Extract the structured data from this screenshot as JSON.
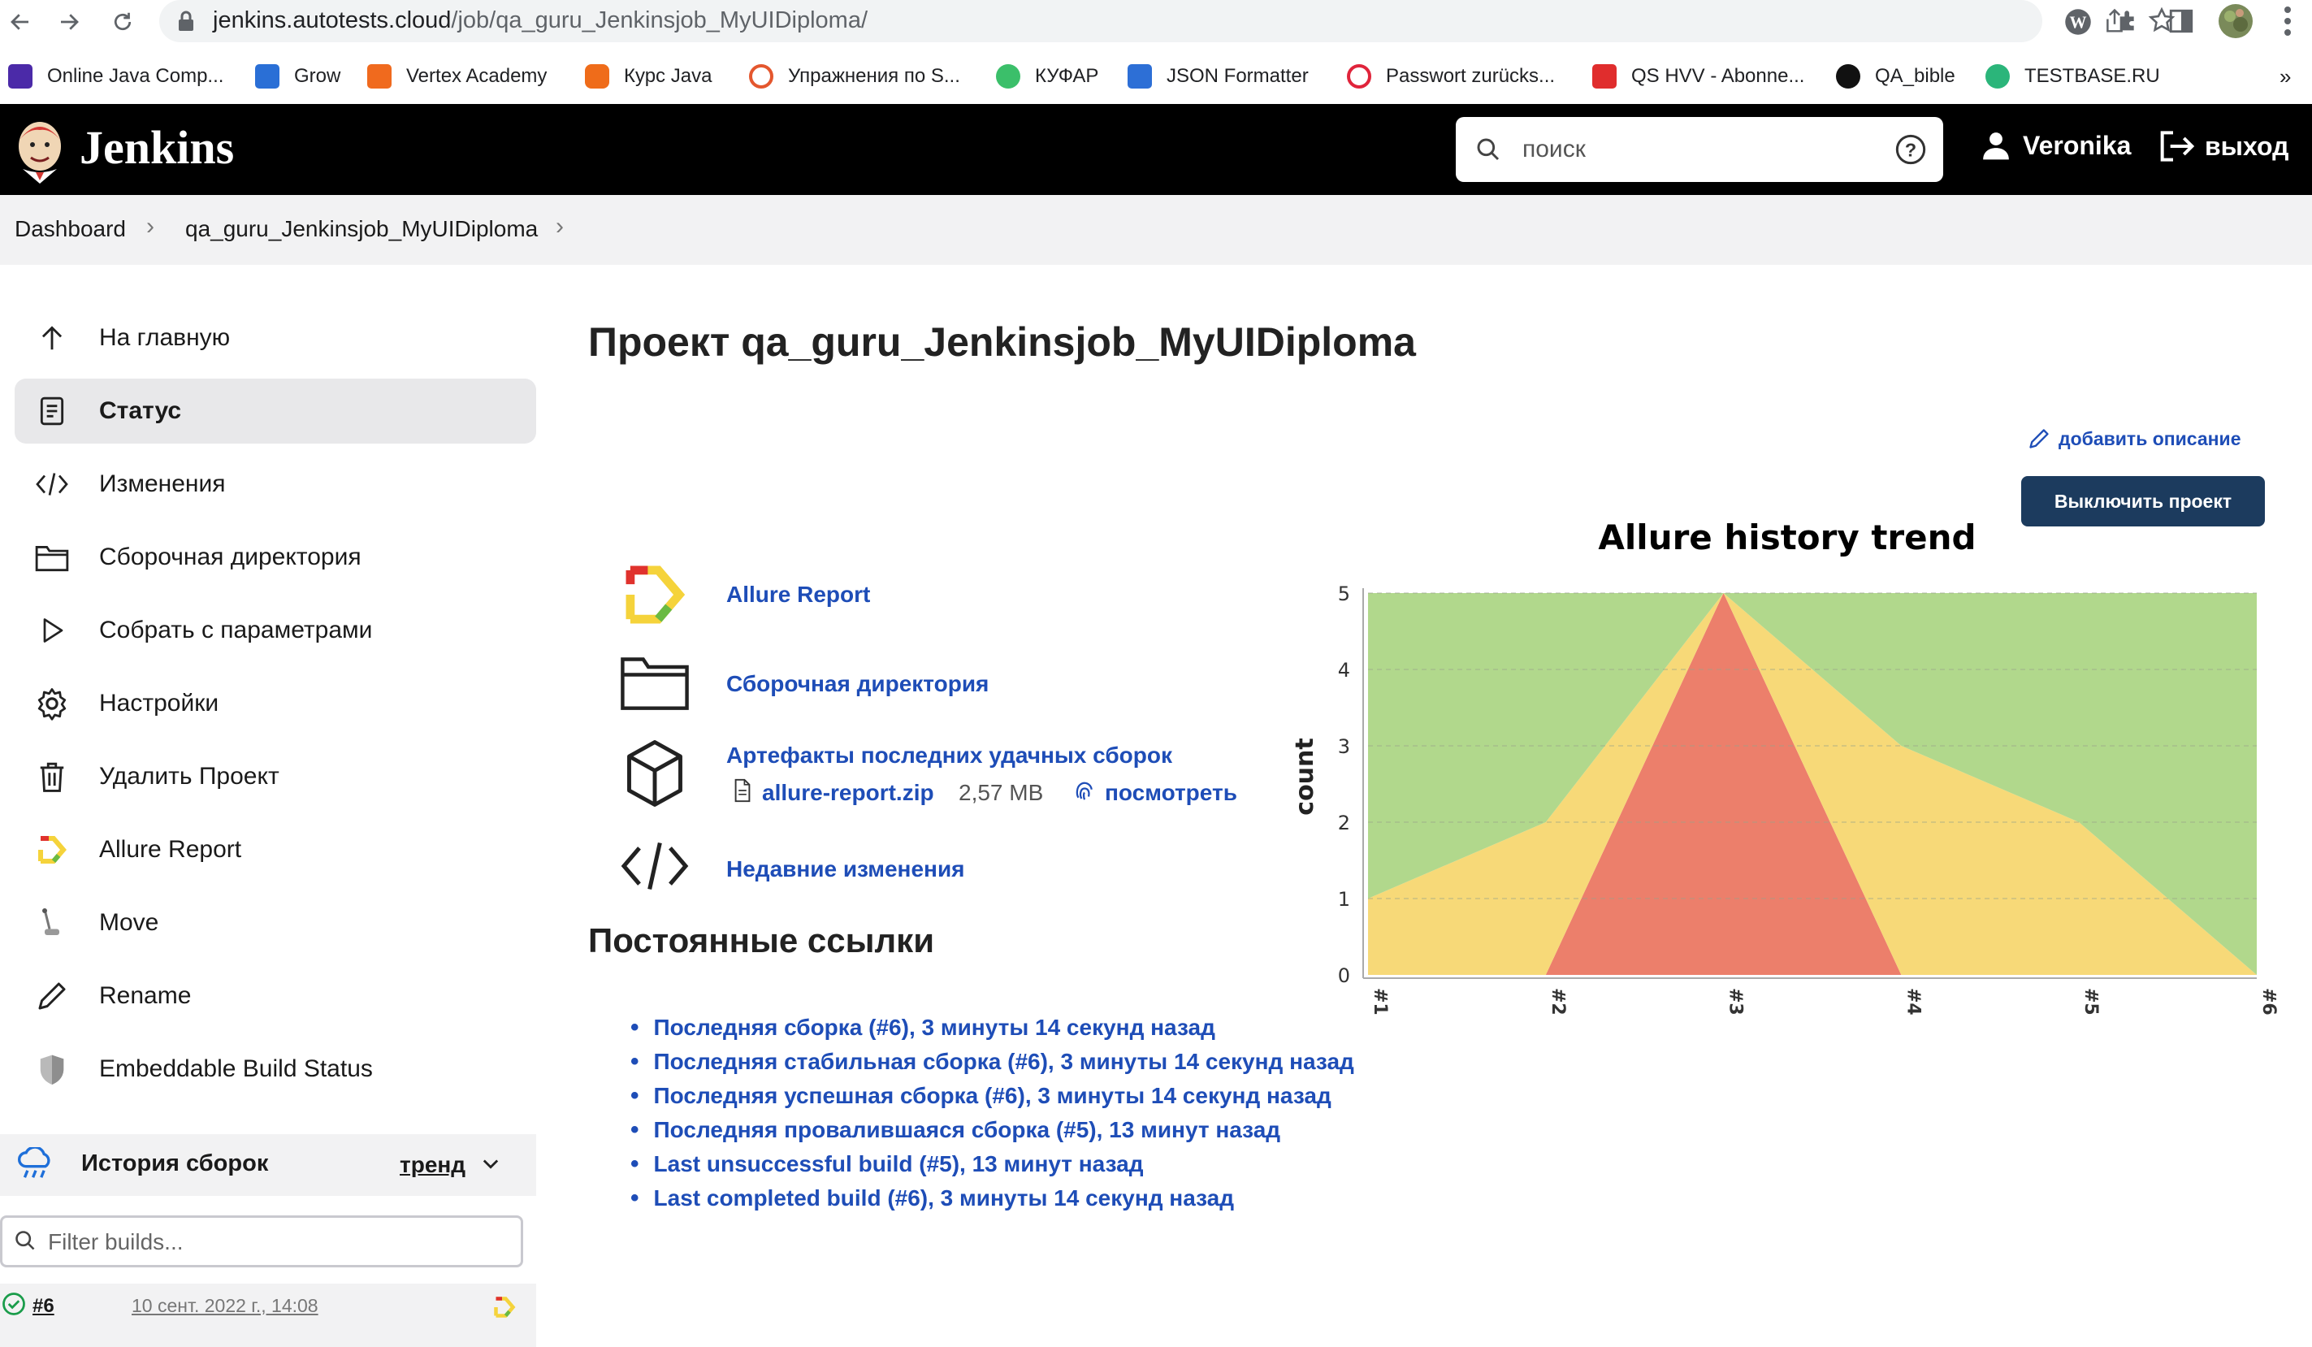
{
  "browser": {
    "url_host": "jenkins.autotests.cloud",
    "url_path": "/job/qa_guru_Jenkinsjob_MyUIDiploma/",
    "bookmarks": [
      {
        "label": "Online Java Comp...",
        "icon": "bolt-icon",
        "color": "#4b2aa8"
      },
      {
        "label": "Grow",
        "icon": "key-icon",
        "color": "#2a6fd6"
      },
      {
        "label": "Vertex Academy",
        "icon": "vertex-icon",
        "color": "#f06a1e"
      },
      {
        "label": "Курс Java",
        "icon": "hexagon-icon",
        "color": "#ef6c1a"
      },
      {
        "label": "Упражнения по S...",
        "icon": "target-icon",
        "color": "#e4572e"
      },
      {
        "label": "КУФАР",
        "icon": "kufar-icon",
        "color": "#3bbf6a"
      },
      {
        "label": "JSON Formatter",
        "icon": "check-icon",
        "color": "#2d6fd6"
      },
      {
        "label": "Passwort zurücks...",
        "icon": "swirl-icon",
        "color": "#e0243b"
      },
      {
        "label": "QS HVV - Abonne...",
        "icon": "play-icon",
        "color": "#e02d2d"
      },
      {
        "label": "QA_bible",
        "icon": "github-icon",
        "color": "#111111"
      },
      {
        "label": "TESTBASE.RU",
        "icon": "gear-icon",
        "color": "#2bb57a"
      }
    ]
  },
  "header": {
    "logo": "Jenkins",
    "search_placeholder": "поиск",
    "user": "Veronika",
    "logout": "выход"
  },
  "breadcrumb": {
    "items": [
      "Dashboard",
      "qa_guru_Jenkinsjob_MyUIDiploma"
    ]
  },
  "sidebar": {
    "items": [
      {
        "label": "На главную",
        "icon": "arrow-up-icon"
      },
      {
        "label": "Статус",
        "icon": "document-icon"
      },
      {
        "label": "Изменения",
        "icon": "code-icon"
      },
      {
        "label": "Сборочная директория",
        "icon": "folder-icon"
      },
      {
        "label": "Собрать с параметрами",
        "icon": "play-icon"
      },
      {
        "label": "Настройки",
        "icon": "gear-icon"
      },
      {
        "label": "Удалить Проект",
        "icon": "trash-icon"
      },
      {
        "label": "Allure Report",
        "icon": "allure-icon"
      },
      {
        "label": "Move",
        "icon": "move-icon"
      },
      {
        "label": "Rename",
        "icon": "pencil-icon"
      },
      {
        "label": "Embeddable Build Status",
        "icon": "shield-icon"
      }
    ],
    "active_index": 1,
    "history": {
      "title": "История сборок",
      "trend": "тренд",
      "filter_placeholder": "Filter builds...",
      "builds": [
        {
          "number": "#6",
          "date": "10 сент. 2022 г., 14:08",
          "status": "success"
        }
      ]
    }
  },
  "main": {
    "title": "Проект qa_guru_Jenkinsjob_MyUIDiploma",
    "add_description": "добавить описание",
    "disable_button": "Выключить проект",
    "links": {
      "allure": "Allure Report",
      "workspace": "Сборочная директория",
      "artifacts": "Артефакты последних удачных сборок",
      "artifact_file": "allure-report.zip",
      "artifact_size": "2,57 MB",
      "artifact_view": "посмотреть",
      "changes": "Недавние изменения"
    },
    "permalinks_title": "Постоянные ссылки",
    "permalinks": [
      "Последняя сборка (#6), 3 минуты 14 секунд назад",
      "Последняя стабильная сборка (#6), 3 минуты 14 секунд назад",
      "Последняя успешная сборка (#6), 3 минуты 14 секунд назад",
      "Последняя провалившаяся сборка (#5), 13 минут назад",
      "Last unsuccessful build (#5), 13 минут назад",
      "Last completed build (#6), 3 минуты 14 секунд назад"
    ]
  },
  "chart_data": {
    "type": "area",
    "title": "Allure history trend",
    "ylabel": "count",
    "xlabel": "",
    "categories": [
      "#1",
      "#2",
      "#3",
      "#4",
      "#5",
      "#6"
    ],
    "ylim": [
      0,
      5
    ],
    "yticks": [
      "0",
      "1",
      "2",
      "3",
      "4",
      "5"
    ],
    "grid": true,
    "stacked": true,
    "series": [
      {
        "key": "failed",
        "color": "#ec7f6b",
        "values": [
          0,
          0,
          5,
          0,
          0,
          0
        ]
      },
      {
        "key": "broken",
        "color": "#f7d978",
        "values": [
          1,
          2,
          0,
          3,
          2,
          0
        ]
      },
      {
        "key": "passed",
        "color": "#b1d88c",
        "values": [
          4,
          3,
          0,
          2,
          3,
          5
        ]
      }
    ]
  }
}
